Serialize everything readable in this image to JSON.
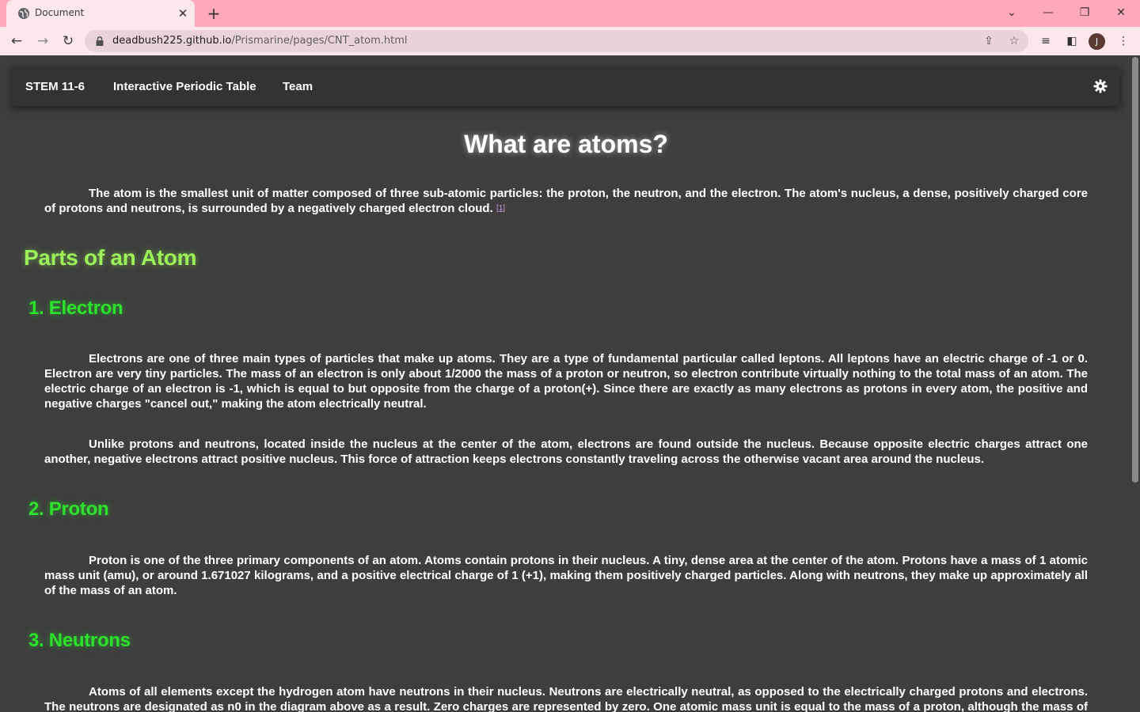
{
  "browser": {
    "tab_title": "Document",
    "url_host": "deadbush225.github.io",
    "url_path": "/Prismarine/pages/CNT_atom.html",
    "profile_initial": "J"
  },
  "nav": {
    "links": [
      "STEM 11-6",
      "Interactive Periodic Table",
      "Team"
    ]
  },
  "article": {
    "title": "What are atoms?",
    "intro": "The atom is the smallest unit of matter composed of three sub-atomic particles: the proton, the neutron, and the electron. The atom's nucleus, a dense, positively charged core of protons and neutrons, is surrounded by a negatively charged electron cloud.",
    "intro_ref": "[1]",
    "parts_heading": "Parts of an Atom",
    "sections": [
      {
        "heading": "1. Electron",
        "paragraphs": [
          "Electrons are one of three main types of particles that make up atoms. They are a type of fundamental particular called leptons. All leptons have an electric charge of -1 or 0. Electron are very tiny particles. The mass of an electron is only about 1/2000 the mass of a proton or neutron, so electron contribute virtually nothing to the total mass of an atom. The electric charge of an electron is -1, which is equal to but opposite from the charge  of a proton(+). Since there are exactly as many electrons as protons in every atom, the positive and negative charges \"cancel out,\" making the atom electrically neutral.",
          "Unlike protons and neutrons, located inside the nucleus at the center of the atom, electrons are found outside the nucleus. Because opposite electric charges attract one another, negative electrons attract positive nucleus. This force of attraction keeps electrons constantly traveling across the otherwise vacant area around the nucleus."
        ]
      },
      {
        "heading": "2. Proton",
        "paragraphs": [
          "Proton is one of the three primary components of an atom. Atoms contain protons in their nucleus. A tiny, dense area at the center of the atom. Protons have a mass of 1 atomic mass unit (amu), or around 1.671027 kilograms, and a positive electrical charge of 1 (+1), making them positively charged particles. Along with neutrons, they make up approximately all of the mass of an atom."
        ]
      },
      {
        "heading": "3. Neutrons",
        "paragraphs": [
          "Atoms of all elements except the hydrogen atom have neutrons in their nucleus. Neutrons are electrically neutral, as opposed to the electrically charged protons and electrons. The neutrons are designated as n0 in the diagram above as a result. Zero charges are represented by zero. One atomic mass unit is equal to the mass of a proton, although the mass of a"
        ]
      }
    ]
  }
}
